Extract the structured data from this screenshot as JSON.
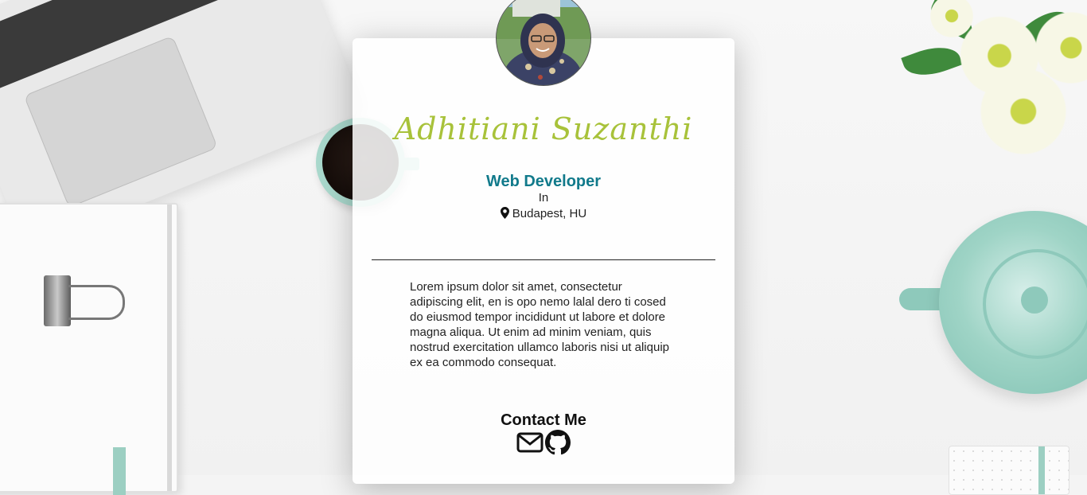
{
  "profile": {
    "name": "Adhitiani Suzanthi",
    "role": "Web Developer",
    "connector": "In",
    "location": "Budapest, HU",
    "bio": "Lorem ipsum dolor sit amet, consectetur adipiscing elit, en is opo nemo lalal dero ti cosed do eiusmod tempor incididunt ut labore et dolore magna aliqua. Ut enim ad minim veniam, quis nostrud exercitation ullamco laboris nisi ut aliquip ex ea commodo consequat."
  },
  "contact": {
    "heading": "Contact Me",
    "links": [
      {
        "icon": "envelope-icon"
      },
      {
        "icon": "github-icon"
      }
    ]
  },
  "colors": {
    "name": "#a8c23a",
    "role": "#117a8b",
    "accent": "#9fd4c6"
  }
}
